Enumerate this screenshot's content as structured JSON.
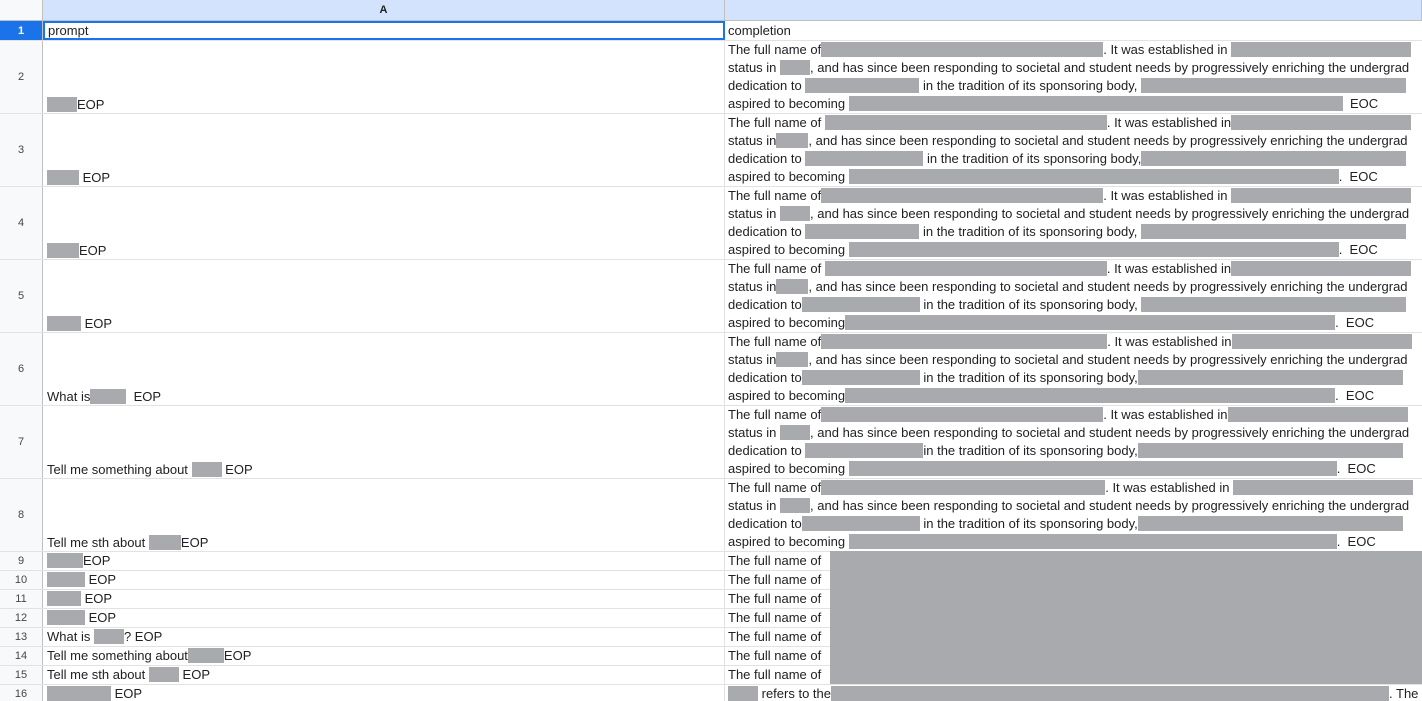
{
  "column_headers": {
    "a": "A",
    "b": ""
  },
  "header_row": {
    "num": "1",
    "prompt": "prompt",
    "completion": "completion"
  },
  "completion_parts": {
    "full_name_of": "The full name of",
    "established_in": ". It was established in",
    "status_in": "status in",
    "responding": ", and has since been responding to societal and student needs by progressively enriching the undergrad",
    "dedication_to": "dedication to",
    "tradition": "in the tradition of its sponsoring body,",
    "aspired": "aspired to becoming",
    "eoc": "EOC",
    "refers_to": "refers to the",
    "the": "The"
  },
  "rows": [
    {
      "num": "2",
      "prompt_pre": "",
      "prompt_post": "EOP"
    },
    {
      "num": "3",
      "prompt_pre": "",
      "prompt_post": "EOP"
    },
    {
      "num": "4",
      "prompt_pre": "",
      "prompt_post": "EOP"
    },
    {
      "num": "5",
      "prompt_pre": "",
      "prompt_post": "EOP"
    },
    {
      "num": "6",
      "prompt_pre": "What is",
      "prompt_post": "EOP"
    },
    {
      "num": "7",
      "prompt_pre": "Tell me something about",
      "prompt_post": "EOP"
    },
    {
      "num": "8",
      "prompt_pre": "Tell me sth about",
      "prompt_post": "EOP"
    },
    {
      "num": "9",
      "prompt_pre": "",
      "prompt_post": "EOP"
    },
    {
      "num": "10",
      "prompt_pre": "",
      "prompt_post": "EOP"
    },
    {
      "num": "11",
      "prompt_pre": "",
      "prompt_post": "EOP"
    },
    {
      "num": "12",
      "prompt_pre": "",
      "prompt_post": "EOP"
    },
    {
      "num": "13",
      "prompt_pre": "What is",
      "prompt_post": "? EOP"
    },
    {
      "num": "14",
      "prompt_pre": "Tell me something about",
      "prompt_post": "EOP"
    },
    {
      "num": "15",
      "prompt_pre": "Tell me sth about",
      "prompt_post": "EOP"
    },
    {
      "num": "16",
      "prompt_pre": "",
      "prompt_post": "EOP"
    }
  ]
}
